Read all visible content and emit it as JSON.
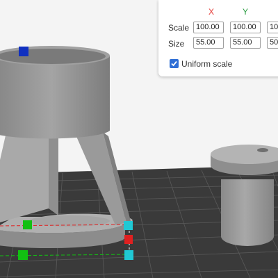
{
  "viewport": {
    "background_color": "#f4f4f4",
    "floor_color": "#3a3a3a",
    "model_color": "#9b9b9b",
    "handles": {
      "top": "#1030c0",
      "x_axis": "#e02020",
      "y_axis": "#12c012",
      "corner": "#20c8d4"
    }
  },
  "scale_panel": {
    "axis_headers": {
      "x": "X",
      "y": "Y"
    },
    "scale": {
      "label": "Scale",
      "x": "100.00",
      "y": "100.00",
      "z": "10"
    },
    "size": {
      "label": "Size",
      "x": "55.00",
      "y": "55.00",
      "z": "50"
    },
    "uniform_scale": {
      "label": "Uniform scale",
      "checked": true
    }
  }
}
